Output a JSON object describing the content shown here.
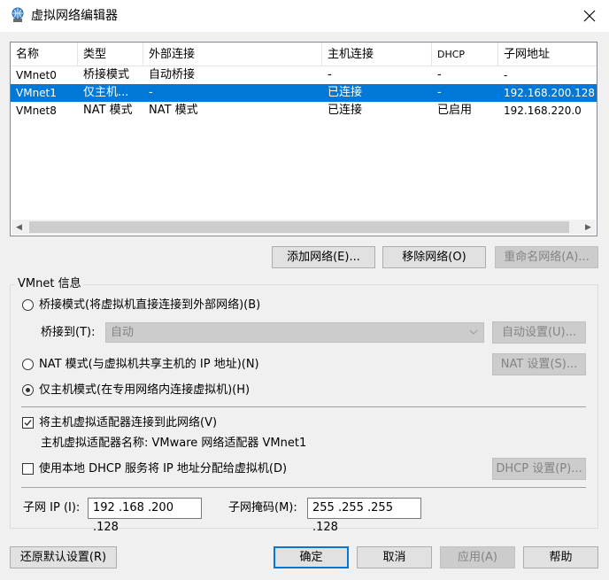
{
  "window": {
    "title": "虚拟网络编辑器",
    "icon": "network-globe-icon",
    "close_icon": "close-icon"
  },
  "table": {
    "columns": [
      "名称",
      "类型",
      "外部连接",
      "主机连接",
      "DHCP",
      "子网地址"
    ],
    "rows": [
      {
        "name": "VMnet0",
        "type": "桥接模式",
        "external": "自动桥接",
        "host": "-",
        "dhcp": "-",
        "subnet": "-"
      },
      {
        "name": "VMnet1",
        "type": "仅主机...",
        "external": "-",
        "host": "已连接",
        "dhcp": "-",
        "subnet": "192.168.200.128"
      },
      {
        "name": "VMnet8",
        "type": "NAT 模式",
        "external": "NAT 模式",
        "host": "已连接",
        "dhcp": "已启用",
        "subnet": "192.168.220.0"
      }
    ],
    "selected_row": "VMnet1"
  },
  "buttons": {
    "add_network": "添加网络(E)...",
    "remove_network": "移除网络(O)",
    "rename_network": "重命名网络(A)...",
    "restore_defaults": "还原默认设置(R)",
    "ok": "确定",
    "cancel": "取消",
    "apply": "应用(A)",
    "help": "帮助"
  },
  "vmnet_info": {
    "group_label": "VMnet 信息",
    "bridged_label": "桥接模式(将虚拟机直接连接到外部网络)(B)",
    "bridge_to_label": "桥接到(T):",
    "bridge_to_value": "自动",
    "auto_settings": "自动设置(U)...",
    "nat_label": "NAT 模式(与虚拟机共享主机的 IP 地址)(N)",
    "nat_settings": "NAT 设置(S)...",
    "host_only_label": "仅主机模式(在专用网络内连接虚拟机)(H)",
    "selected_mode": "host_only",
    "connect_adapter_label": "将主机虚拟适配器连接到此网络(V)",
    "connect_adapter_checked": true,
    "adapter_name_label": "主机虚拟适配器名称: VMware 网络适配器 VMnet1",
    "dhcp_label": "使用本地 DHCP 服务将 IP 地址分配给虚拟机(D)",
    "dhcp_checked": false,
    "dhcp_settings": "DHCP 设置(P)...",
    "subnet_ip_label": "子网 IP (I):",
    "subnet_ip_value": "192 .168 .200 .128",
    "subnet_mask_label": "子网掩码(M):",
    "subnet_mask_value": "255 .255 .255 .128"
  },
  "colors": {
    "selection": "#0078d7",
    "disabled_text": "#838383",
    "focus_border": "#0078d7"
  }
}
